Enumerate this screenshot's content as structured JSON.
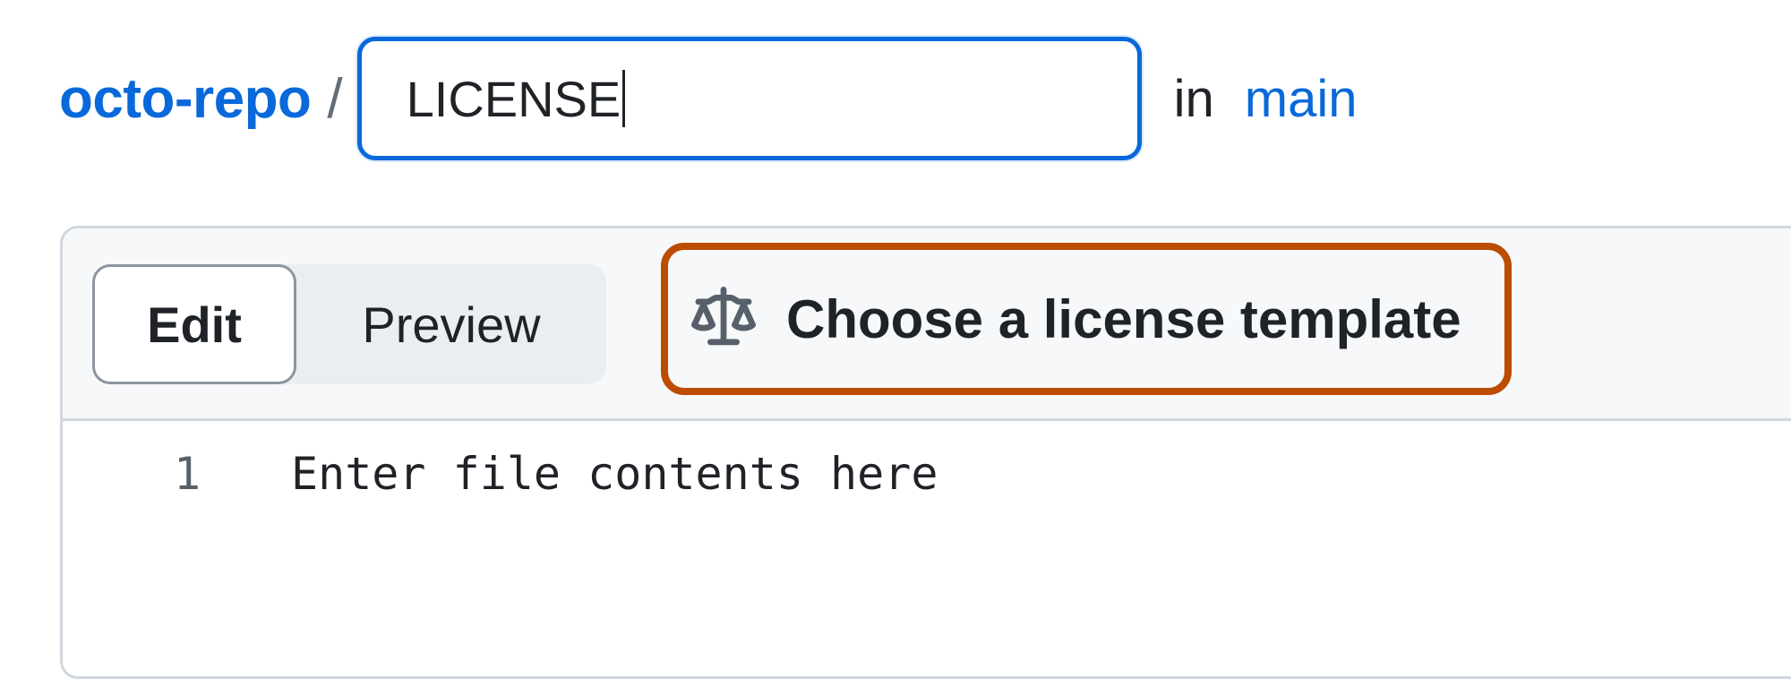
{
  "header": {
    "repo_name": "octo-repo",
    "separator": "/",
    "filename_value": "LICENSE",
    "in_label": "in",
    "branch": "main"
  },
  "editor": {
    "tabs": [
      {
        "label": "Edit",
        "selected": true
      },
      {
        "label": "Preview",
        "selected": false
      }
    ],
    "license_button": {
      "label": "Choose a license template",
      "icon": "law-scale-icon",
      "highlight_color": "#bc4c00"
    },
    "lines": [
      {
        "number": "1",
        "text": "Enter file contents here"
      }
    ]
  },
  "colors": {
    "link": "#0969da",
    "focus_border": "#0969da",
    "highlight": "#bc4c00"
  }
}
